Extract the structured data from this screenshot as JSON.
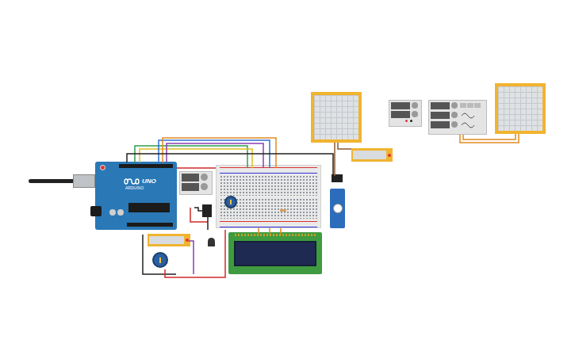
{
  "board": {
    "brand": "ARDUINO",
    "model": "UNO"
  },
  "wires": [
    {
      "color": "#2e9e4f"
    },
    {
      "color": "#e0c020"
    },
    {
      "color": "#2f6fd6"
    },
    {
      "color": "#e08a20"
    },
    {
      "color": "#8a3fb0"
    },
    {
      "color": "#222222"
    },
    {
      "color": "#d02a2a"
    },
    {
      "color": "#222222"
    },
    {
      "color": "#d02a2a"
    },
    {
      "color": "#8a3fb0"
    },
    {
      "color": "#e08a20"
    },
    {
      "color": "#8b5a2b"
    },
    {
      "color": "#222222"
    },
    {
      "color": "#8b5a2b"
    },
    {
      "color": "#e08a20"
    },
    {
      "color": "#d02a2a"
    },
    {
      "color": "#222222"
    },
    {
      "color": "#e08a20"
    },
    {
      "color": "#e08a20"
    },
    {
      "color": "#e08a20"
    }
  ]
}
